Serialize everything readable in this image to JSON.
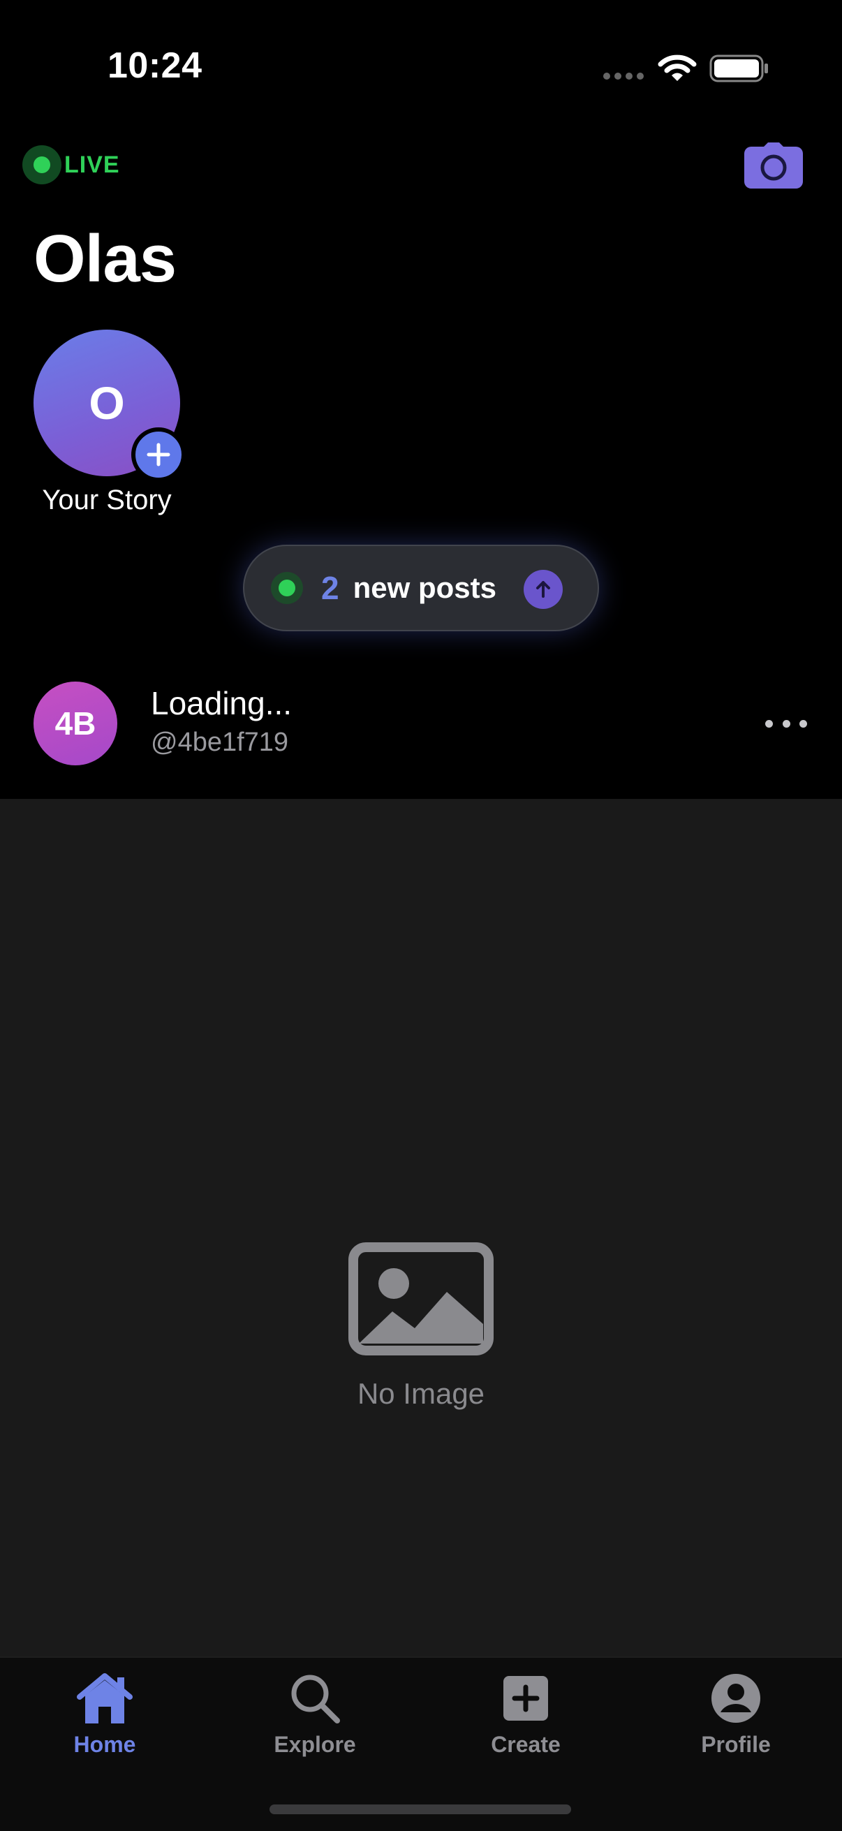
{
  "status_bar": {
    "time": "10:24"
  },
  "header": {
    "live_label": "LIVE",
    "title": "Olas",
    "camera_icon": "camera-icon"
  },
  "stories": [
    {
      "initial": "O",
      "label": "Your Story",
      "add_icon": "plus-icon"
    }
  ],
  "new_posts": {
    "count": "2",
    "text": "new posts",
    "icon": "arrow-up-icon"
  },
  "post": {
    "avatar_initials": "4B",
    "name": "Loading...",
    "handle": "@4be1f719",
    "menu_icon": "ellipsis-icon",
    "placeholder_icon": "image-icon",
    "placeholder_text": "No Image"
  },
  "tabs": [
    {
      "label": "Home",
      "icon": "home-icon",
      "active": true
    },
    {
      "label": "Explore",
      "icon": "search-icon",
      "active": false
    },
    {
      "label": "Create",
      "icon": "plus-square-icon",
      "active": false
    },
    {
      "label": "Profile",
      "icon": "person-circle-icon",
      "active": false
    }
  ],
  "colors": {
    "accent": "#6e83e6",
    "live_green": "#2fd158",
    "background": "#000000",
    "image_placeholder": "#1a1a1a",
    "inactive_tab": "#8e8e93"
  }
}
